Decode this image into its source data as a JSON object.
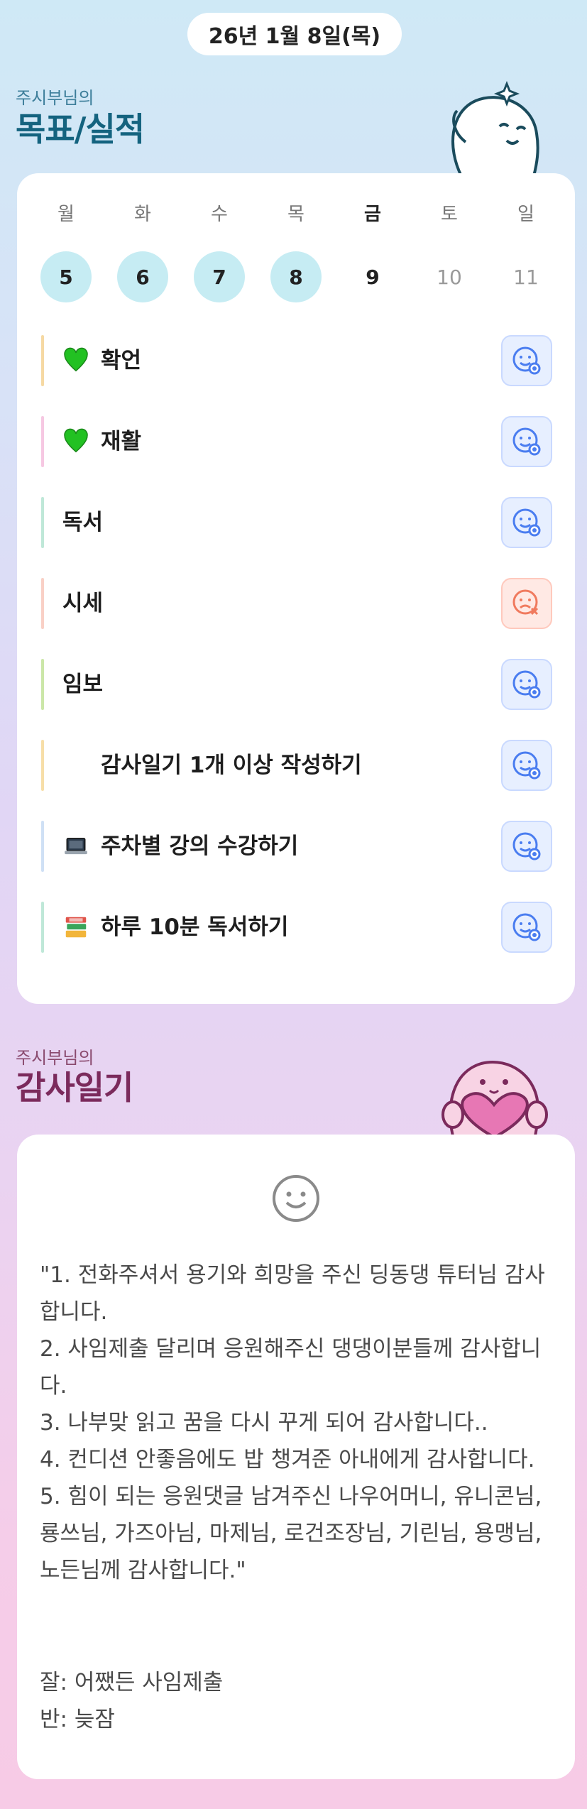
{
  "date": "26년 1월 8일(목)",
  "goals_section": {
    "subtitle": "주시부님의",
    "title": "목표/실적"
  },
  "week": [
    {
      "day": "월",
      "date": "5",
      "state": "done"
    },
    {
      "day": "화",
      "date": "6",
      "state": "done"
    },
    {
      "day": "수",
      "date": "7",
      "state": "done"
    },
    {
      "day": "목",
      "date": "8",
      "state": "done"
    },
    {
      "day": "금",
      "date": "9",
      "state": "current"
    },
    {
      "day": "토",
      "date": "10",
      "state": "future"
    },
    {
      "day": "일",
      "date": "11",
      "state": "future"
    }
  ],
  "tasks": [
    {
      "label": "확언",
      "icon": "green-heart-icon",
      "status": "success",
      "bar_color": "#f6d9a3"
    },
    {
      "label": "재활",
      "icon": "green-heart-icon",
      "status": "success",
      "bar_color": "#f6c8e2"
    },
    {
      "label": "독서",
      "icon": "",
      "status": "success",
      "bar_color": "#bfe8d8"
    },
    {
      "label": "시세",
      "icon": "",
      "status": "fail",
      "bar_color": "#f9d0c6"
    },
    {
      "label": "임보",
      "icon": "",
      "status": "success",
      "bar_color": "#cbe7a8"
    },
    {
      "label": "감사일기 1개 이상 작성하기",
      "icon": "blank",
      "status": "success",
      "bar_color": "#f7dea8"
    },
    {
      "label": "주차별 강의 수강하기",
      "icon": "laptop-icon",
      "status": "success",
      "bar_color": "#cfe0f5"
    },
    {
      "label": "하루 10분 독서하기",
      "icon": "books-icon",
      "status": "success",
      "bar_color": "#bfe8d8"
    }
  ],
  "diary_section": {
    "subtitle": "주시부님의",
    "title": "감사일기"
  },
  "diary": {
    "text": "\"1. 전화주셔서 용기와 희망을 주신 딩동댕 튜터님 감사합니다.\n2. 사임제출 달리며 응원해주신 댕댕이분들께 감사합니다.\n3. 나부맞 읽고 꿈을 다시 꾸게 되어 감사합니다..\n4. 컨디션 안좋음에도 밥 챙겨준 아내에게 감사합니다.\n5. 힘이 되는 응원댓글 남겨주신 나우어머니, 유니콘님, 룡쓰님, 가즈아님, 마제님, 로건조장님, 기린님, 용맹님, 노든님께 감사합니다.\"",
    "good": "잘: 어쨌든 사임제출",
    "bad": "반: 늦잠"
  },
  "colors": {
    "done_circle": "#c6ecf3",
    "ok_icon": "#4a7df0",
    "fail_icon": "#f07a5e"
  }
}
